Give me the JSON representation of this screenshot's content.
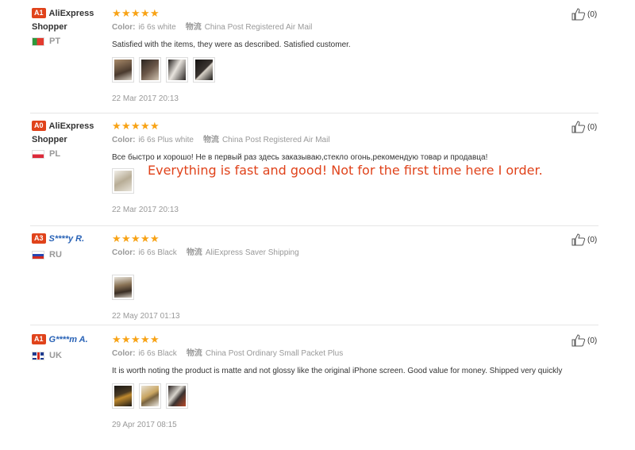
{
  "reviews": [
    {
      "badge": "A1",
      "user": "AliExpress Shopper",
      "country": "PT",
      "rating": 5,
      "color_label": "Color:",
      "color_value": "i6 6s white",
      "shipping_label": "物流",
      "shipping_value": "China Post Registered Air Mail",
      "text": "Satisfied with the items, they were as described. Satisfied customer.",
      "photo_count": 4,
      "date": "22 Mar 2017 20:13",
      "likes": "(0)"
    },
    {
      "badge": "A0",
      "user": "AliExpress Shopper",
      "country": "PL",
      "rating": 5,
      "color_label": "Color:",
      "color_value": "i6 6s Plus white",
      "shipping_label": "物流",
      "shipping_value": "China Post Registered Air Mail",
      "text": "Все быстро и хорошо! Не в первый раз здесь заказываю,стекло огонь,рекомендую товар и продавца!",
      "translation": "Everything is fast and good! Not for the first time here I order.",
      "photo_count": 1,
      "date": "22 Mar 2017 20:13",
      "likes": "(0)"
    },
    {
      "badge": "A3",
      "user": "S****y R.",
      "country": "RU",
      "rating": 5,
      "color_label": "Color:",
      "color_value": "i6 6s Black",
      "shipping_label": "物流",
      "shipping_value": "AliExpress Saver Shipping",
      "text": "",
      "photo_count": 1,
      "date": "22 May 2017 01:13",
      "likes": "(0)"
    },
    {
      "badge": "A1",
      "user": "G****m A.",
      "country": "UK",
      "rating": 5,
      "color_label": "Color:",
      "color_value": "i6 6s Black",
      "shipping_label": "物流",
      "shipping_value": "China Post Ordinary Small Packet Plus",
      "text": "It is worth noting the product is matte and not glossy like the original iPhone screen. Good value for money. Shipped very quickly",
      "photo_count": 3,
      "date": "29 Apr 2017 08:15",
      "likes": "(0)"
    }
  ],
  "colors": {
    "badge": "#e0431b",
    "star": "#f8a316",
    "masked_user": "#2862b6",
    "translation": "#e0431b"
  },
  "icons": {
    "like": "thumbs-up-icon",
    "star": "star-icon"
  }
}
